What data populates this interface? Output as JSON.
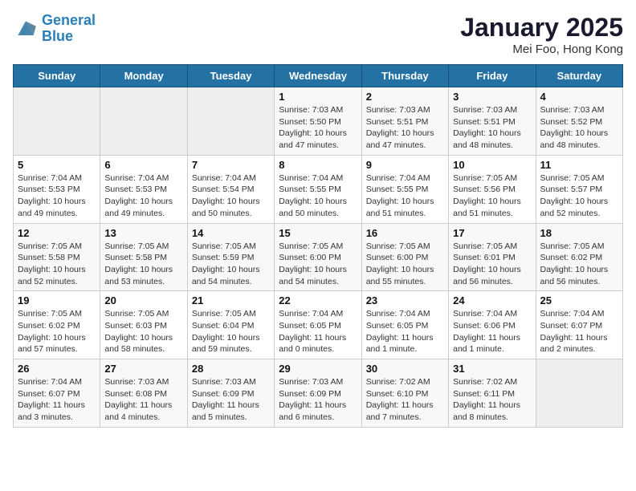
{
  "header": {
    "logo_line1": "General",
    "logo_line2": "Blue",
    "month": "January 2025",
    "location": "Mei Foo, Hong Kong"
  },
  "weekdays": [
    "Sunday",
    "Monday",
    "Tuesday",
    "Wednesday",
    "Thursday",
    "Friday",
    "Saturday"
  ],
  "weeks": [
    [
      {
        "day": "",
        "sunrise": "",
        "sunset": "",
        "daylight": "",
        "empty": true
      },
      {
        "day": "",
        "sunrise": "",
        "sunset": "",
        "daylight": "",
        "empty": true
      },
      {
        "day": "",
        "sunrise": "",
        "sunset": "",
        "daylight": "",
        "empty": true
      },
      {
        "day": "1",
        "sunrise": "Sunrise: 7:03 AM",
        "sunset": "Sunset: 5:50 PM",
        "daylight": "Daylight: 10 hours and 47 minutes.",
        "empty": false
      },
      {
        "day": "2",
        "sunrise": "Sunrise: 7:03 AM",
        "sunset": "Sunset: 5:51 PM",
        "daylight": "Daylight: 10 hours and 47 minutes.",
        "empty": false
      },
      {
        "day": "3",
        "sunrise": "Sunrise: 7:03 AM",
        "sunset": "Sunset: 5:51 PM",
        "daylight": "Daylight: 10 hours and 48 minutes.",
        "empty": false
      },
      {
        "day": "4",
        "sunrise": "Sunrise: 7:03 AM",
        "sunset": "Sunset: 5:52 PM",
        "daylight": "Daylight: 10 hours and 48 minutes.",
        "empty": false
      }
    ],
    [
      {
        "day": "5",
        "sunrise": "Sunrise: 7:04 AM",
        "sunset": "Sunset: 5:53 PM",
        "daylight": "Daylight: 10 hours and 49 minutes.",
        "empty": false
      },
      {
        "day": "6",
        "sunrise": "Sunrise: 7:04 AM",
        "sunset": "Sunset: 5:53 PM",
        "daylight": "Daylight: 10 hours and 49 minutes.",
        "empty": false
      },
      {
        "day": "7",
        "sunrise": "Sunrise: 7:04 AM",
        "sunset": "Sunset: 5:54 PM",
        "daylight": "Daylight: 10 hours and 50 minutes.",
        "empty": false
      },
      {
        "day": "8",
        "sunrise": "Sunrise: 7:04 AM",
        "sunset": "Sunset: 5:55 PM",
        "daylight": "Daylight: 10 hours and 50 minutes.",
        "empty": false
      },
      {
        "day": "9",
        "sunrise": "Sunrise: 7:04 AM",
        "sunset": "Sunset: 5:55 PM",
        "daylight": "Daylight: 10 hours and 51 minutes.",
        "empty": false
      },
      {
        "day": "10",
        "sunrise": "Sunrise: 7:05 AM",
        "sunset": "Sunset: 5:56 PM",
        "daylight": "Daylight: 10 hours and 51 minutes.",
        "empty": false
      },
      {
        "day": "11",
        "sunrise": "Sunrise: 7:05 AM",
        "sunset": "Sunset: 5:57 PM",
        "daylight": "Daylight: 10 hours and 52 minutes.",
        "empty": false
      }
    ],
    [
      {
        "day": "12",
        "sunrise": "Sunrise: 7:05 AM",
        "sunset": "Sunset: 5:58 PM",
        "daylight": "Daylight: 10 hours and 52 minutes.",
        "empty": false
      },
      {
        "day": "13",
        "sunrise": "Sunrise: 7:05 AM",
        "sunset": "Sunset: 5:58 PM",
        "daylight": "Daylight: 10 hours and 53 minutes.",
        "empty": false
      },
      {
        "day": "14",
        "sunrise": "Sunrise: 7:05 AM",
        "sunset": "Sunset: 5:59 PM",
        "daylight": "Daylight: 10 hours and 54 minutes.",
        "empty": false
      },
      {
        "day": "15",
        "sunrise": "Sunrise: 7:05 AM",
        "sunset": "Sunset: 6:00 PM",
        "daylight": "Daylight: 10 hours and 54 minutes.",
        "empty": false
      },
      {
        "day": "16",
        "sunrise": "Sunrise: 7:05 AM",
        "sunset": "Sunset: 6:00 PM",
        "daylight": "Daylight: 10 hours and 55 minutes.",
        "empty": false
      },
      {
        "day": "17",
        "sunrise": "Sunrise: 7:05 AM",
        "sunset": "Sunset: 6:01 PM",
        "daylight": "Daylight: 10 hours and 56 minutes.",
        "empty": false
      },
      {
        "day": "18",
        "sunrise": "Sunrise: 7:05 AM",
        "sunset": "Sunset: 6:02 PM",
        "daylight": "Daylight: 10 hours and 56 minutes.",
        "empty": false
      }
    ],
    [
      {
        "day": "19",
        "sunrise": "Sunrise: 7:05 AM",
        "sunset": "Sunset: 6:02 PM",
        "daylight": "Daylight: 10 hours and 57 minutes.",
        "empty": false
      },
      {
        "day": "20",
        "sunrise": "Sunrise: 7:05 AM",
        "sunset": "Sunset: 6:03 PM",
        "daylight": "Daylight: 10 hours and 58 minutes.",
        "empty": false
      },
      {
        "day": "21",
        "sunrise": "Sunrise: 7:05 AM",
        "sunset": "Sunset: 6:04 PM",
        "daylight": "Daylight: 10 hours and 59 minutes.",
        "empty": false
      },
      {
        "day": "22",
        "sunrise": "Sunrise: 7:04 AM",
        "sunset": "Sunset: 6:05 PM",
        "daylight": "Daylight: 11 hours and 0 minutes.",
        "empty": false
      },
      {
        "day": "23",
        "sunrise": "Sunrise: 7:04 AM",
        "sunset": "Sunset: 6:05 PM",
        "daylight": "Daylight: 11 hours and 1 minute.",
        "empty": false
      },
      {
        "day": "24",
        "sunrise": "Sunrise: 7:04 AM",
        "sunset": "Sunset: 6:06 PM",
        "daylight": "Daylight: 11 hours and 1 minute.",
        "empty": false
      },
      {
        "day": "25",
        "sunrise": "Sunrise: 7:04 AM",
        "sunset": "Sunset: 6:07 PM",
        "daylight": "Daylight: 11 hours and 2 minutes.",
        "empty": false
      }
    ],
    [
      {
        "day": "26",
        "sunrise": "Sunrise: 7:04 AM",
        "sunset": "Sunset: 6:07 PM",
        "daylight": "Daylight: 11 hours and 3 minutes.",
        "empty": false
      },
      {
        "day": "27",
        "sunrise": "Sunrise: 7:03 AM",
        "sunset": "Sunset: 6:08 PM",
        "daylight": "Daylight: 11 hours and 4 minutes.",
        "empty": false
      },
      {
        "day": "28",
        "sunrise": "Sunrise: 7:03 AM",
        "sunset": "Sunset: 6:09 PM",
        "daylight": "Daylight: 11 hours and 5 minutes.",
        "empty": false
      },
      {
        "day": "29",
        "sunrise": "Sunrise: 7:03 AM",
        "sunset": "Sunset: 6:09 PM",
        "daylight": "Daylight: 11 hours and 6 minutes.",
        "empty": false
      },
      {
        "day": "30",
        "sunrise": "Sunrise: 7:02 AM",
        "sunset": "Sunset: 6:10 PM",
        "daylight": "Daylight: 11 hours and 7 minutes.",
        "empty": false
      },
      {
        "day": "31",
        "sunrise": "Sunrise: 7:02 AM",
        "sunset": "Sunset: 6:11 PM",
        "daylight": "Daylight: 11 hours and 8 minutes.",
        "empty": false
      },
      {
        "day": "",
        "sunrise": "",
        "sunset": "",
        "daylight": "",
        "empty": true
      }
    ]
  ]
}
